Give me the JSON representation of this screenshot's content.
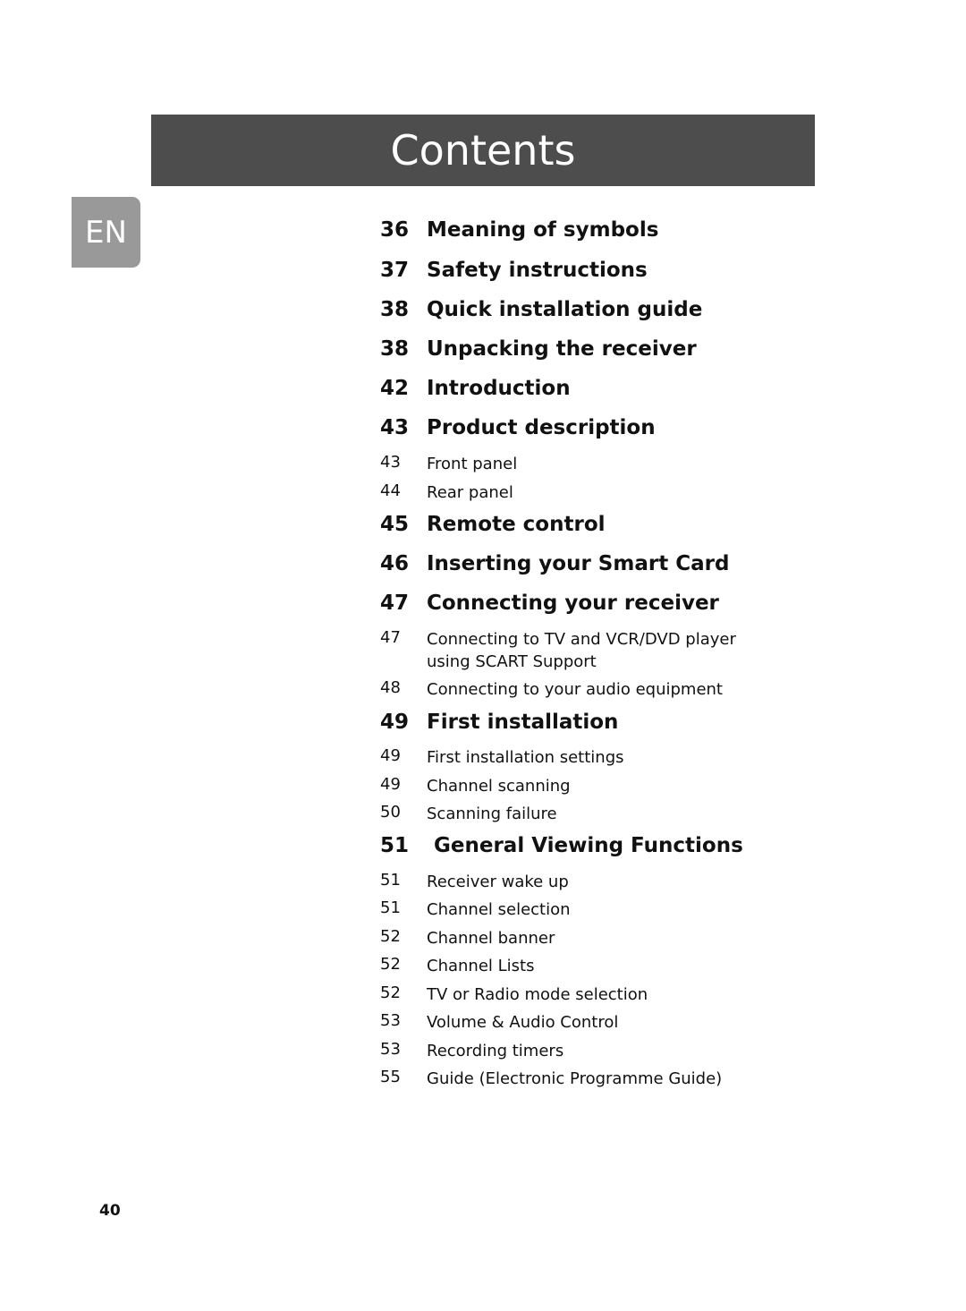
{
  "header": {
    "title": "Contents"
  },
  "language_badge": "EN",
  "toc": [
    {
      "page": "36",
      "title": "Meaning of symbols",
      "level": "major"
    },
    {
      "page": "37",
      "title": "Safety instructions",
      "level": "major"
    },
    {
      "page": "38",
      "title": "Quick installation guide",
      "level": "major"
    },
    {
      "page": "38",
      "title": "Unpacking the receiver",
      "level": "major"
    },
    {
      "page": "42",
      "title": "Introduction",
      "level": "major"
    },
    {
      "page": "43",
      "title": "Product description",
      "level": "major"
    },
    {
      "page": "43",
      "title": "Front panel",
      "level": "minor"
    },
    {
      "page": "44",
      "title": "Rear panel",
      "level": "minor"
    },
    {
      "page": "45",
      "title": "Remote control",
      "level": "major"
    },
    {
      "page": "46",
      "title": "Inserting your Smart Card",
      "level": "major"
    },
    {
      "page": "47",
      "title": "Connecting your receiver",
      "level": "major"
    },
    {
      "page": "47",
      "title": "Connecting to TV and VCR/DVD player using SCART Support",
      "level": "minor"
    },
    {
      "page": "48",
      "title": "Connecting to your audio equipment",
      "level": "minor"
    },
    {
      "page": "49",
      "title": "First installation",
      "level": "major"
    },
    {
      "page": "49",
      "title": "First installation settings",
      "level": "minor"
    },
    {
      "page": "49",
      "title": "Channel scanning",
      "level": "minor"
    },
    {
      "page": "50",
      "title": "Scanning failure",
      "level": "minor"
    },
    {
      "page": "51",
      "title": "General Viewing Functions",
      "level": "major"
    },
    {
      "page": "51",
      "title": "Receiver wake up",
      "level": "minor"
    },
    {
      "page": "51",
      "title": "Channel selection",
      "level": "minor"
    },
    {
      "page": "52",
      "title": "Channel banner",
      "level": "minor"
    },
    {
      "page": "52",
      "title": "Channel Lists",
      "level": "minor"
    },
    {
      "page": "52",
      "title": "TV or Radio mode selection",
      "level": "minor"
    },
    {
      "page": "53",
      "title": "Volume & Audio Control",
      "level": "minor"
    },
    {
      "page": "53",
      "title": "Recording timers",
      "level": "minor"
    },
    {
      "page": "55",
      "title": "Guide (Electronic Programme Guide)",
      "level": "minor"
    }
  ],
  "footer": {
    "page_number": "40"
  }
}
